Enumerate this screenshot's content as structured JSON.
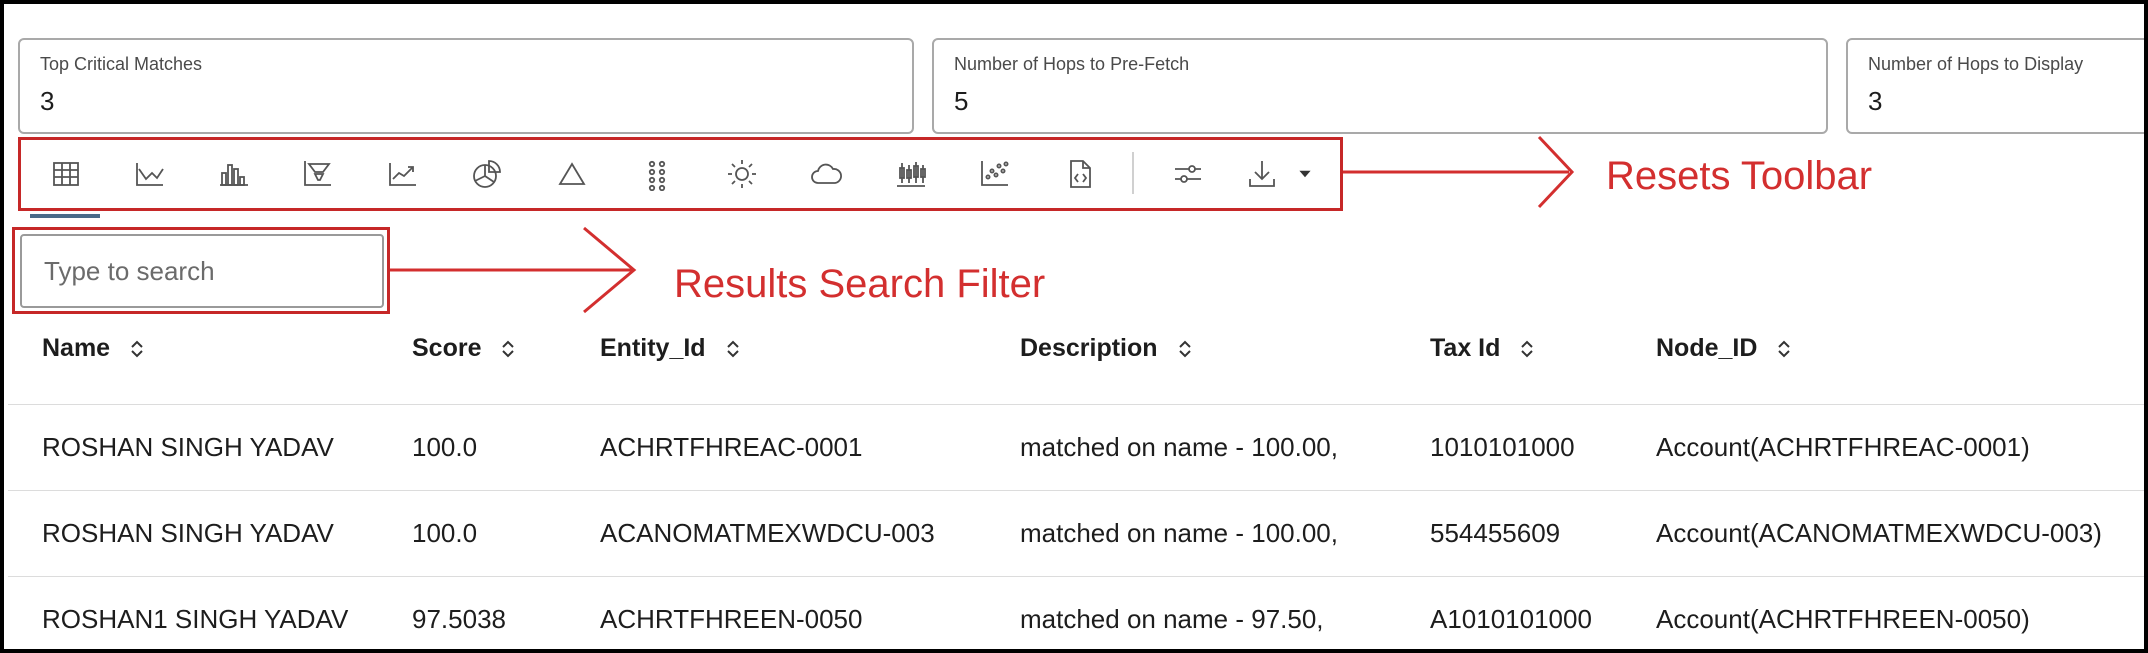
{
  "params": [
    {
      "label": "Top Critical Matches",
      "value": "3"
    },
    {
      "label": "Number of Hops to Pre-Fetch",
      "value": "5"
    },
    {
      "label": "Number of Hops to Display",
      "value": "3"
    }
  ],
  "toolbar": {
    "icons": [
      "table-icon",
      "line-chart-icon",
      "bar-chart-icon",
      "funnel-chart-icon",
      "area-chart-icon",
      "pie-chart-icon",
      "pyramid-icon",
      "dot-grid-icon",
      "sunburst-icon",
      "tag-cloud-icon",
      "box-plot-icon",
      "scatter-chart-icon",
      "code-file-icon",
      "settings-sliders-icon",
      "download-icon",
      "caret-down-icon"
    ]
  },
  "search": {
    "placeholder": "Type to search",
    "value": ""
  },
  "annotations": {
    "toolbar": "Resets Toolbar",
    "search": "Results Search Filter"
  },
  "table": {
    "columns": [
      "Name",
      "Score",
      "Entity_Id",
      "Description",
      "Tax Id",
      "Node_ID"
    ],
    "rows": [
      [
        "ROSHAN SINGH YADAV",
        "100.0",
        "ACHRTFHREAC-0001",
        "matched on name - 100.00,",
        "1010101000",
        "Account(ACHRTFHREAC-0001)"
      ],
      [
        "ROSHAN SINGH YADAV",
        "100.0",
        "ACANOMATMEXWDCU-003",
        "matched on name - 100.00,",
        "554455609",
        "Account(ACANOMATMEXWDCU-003)"
      ],
      [
        "ROSHAN1 SINGH YADAV",
        "97.5038",
        "ACHRTFHREEN-0050",
        "matched on name - 97.50,",
        "A1010101000",
        "Account(ACHRTFHREEN-0050)"
      ]
    ]
  },
  "colors": {
    "annotation": "#d32f2f",
    "active_tab": "#4a6a88"
  }
}
